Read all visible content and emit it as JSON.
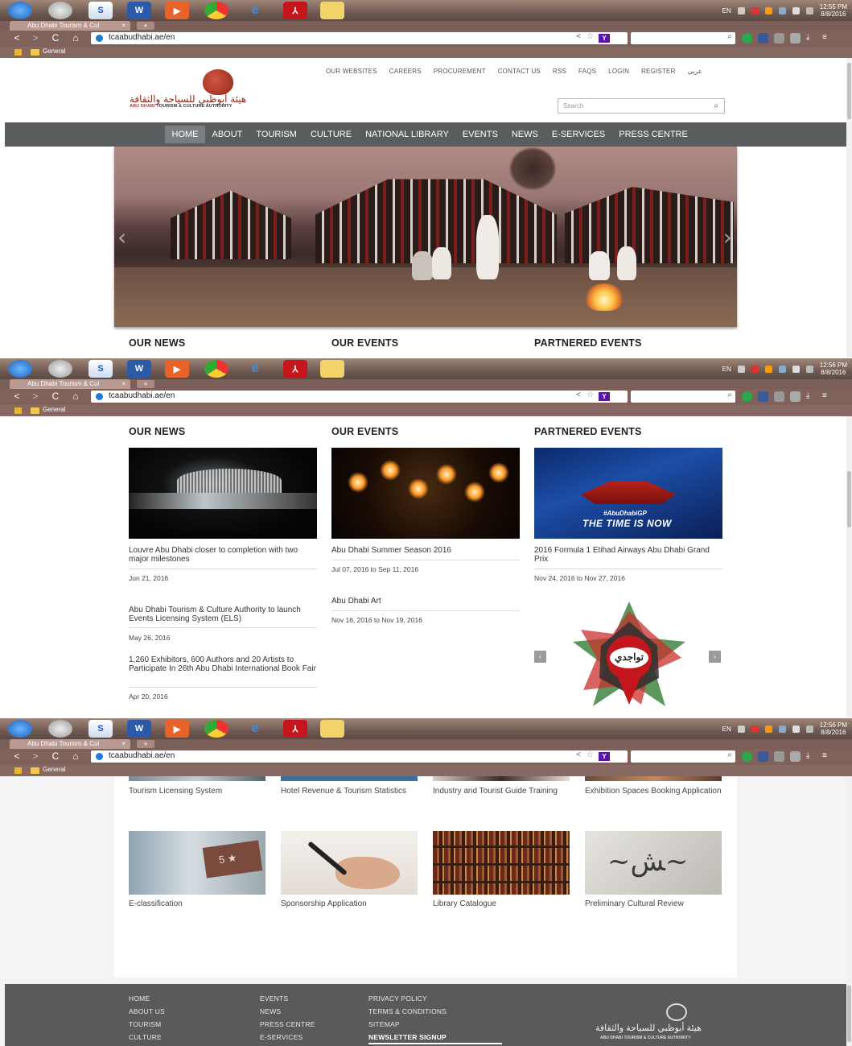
{
  "os": {
    "taskbar_apps": [
      "windows-orb",
      "media-icon",
      "snagit-icon",
      "word-icon",
      "video-icon",
      "chrome-icon",
      "ie-icon",
      "acrobat-icon",
      "folder-icon"
    ],
    "word_label": "W",
    "language": "EN",
    "clocks": [
      {
        "time": "12:55 PM",
        "date": "8/8/2016"
      },
      {
        "time": "12:56 PM",
        "date": "8/8/2016"
      },
      {
        "time": "12:56 PM",
        "date": "8/8/2016"
      }
    ]
  },
  "browser": {
    "tab_title": "Abu Dhabi Tourism & Cul",
    "tab_close": "×",
    "new_tab": "+",
    "url": "tcaabudhabi.ae/en",
    "yahoo_label": "Y",
    "bookmark_folder": "General",
    "nav": {
      "back": "<",
      "forward": ">",
      "reload": "C",
      "home": "⌂"
    }
  },
  "site": {
    "top_links": [
      "OUR WEBSITES",
      "CAREERS",
      "PROCUREMENT",
      "CONTACT US",
      "RSS",
      "FAQS",
      "LOGIN",
      "REGISTER",
      "عربي"
    ],
    "logo_arabic": "هيئة أبوظبي للسياحة والثقافة",
    "logo_english_1": "ABU DHABI",
    "logo_english_2": " TOURISM & CULTURE AUTHORITY",
    "search_placeholder": "Search",
    "main_nav": [
      "HOME",
      "ABOUT",
      "TOURISM",
      "CULTURE",
      "NATIONAL LIBRARY",
      "EVENTS",
      "NEWS",
      "E-SERVICES",
      "PRESS CENTRE"
    ],
    "active_nav": "HOME",
    "hero_prev": "‹",
    "hero_next": "›",
    "sections": [
      "OUR NEWS",
      "OUR EVENTS",
      "PARTNERED EVENTS"
    ]
  },
  "news": [
    {
      "title": "Louvre Abu Dhabi closer to completion with two major milestones",
      "date": "Jun 21, 2016"
    },
    {
      "title": "Abu Dhabi Tourism & Culture Authority to launch Events Licensing System (ELS)",
      "date": "May 26, 2016"
    },
    {
      "title": "1,260 Exhibitors, 600 Authors and 20 Artists to Participate In 26th Abu Dhabi International Book Fair",
      "date": "Apr 20, 2016"
    }
  ],
  "events": [
    {
      "title": "Abu Dhabi Summer Season 2016",
      "date": "Jul 07, 2016 to Sep 11, 2016"
    },
    {
      "title": "Abu Dhabi Art",
      "date": "Nov 16, 2016 to Nov 19, 2016"
    }
  ],
  "partnered": {
    "title": "2016 Formula 1 Etihad Airways Abu Dhabi Grand Prix",
    "date": "Nov 24, 2016 to Nov 27, 2016",
    "image_text_1": "#AbuDhabiGP",
    "image_text_2": "THE TIME IS NOW",
    "badge_text": "تواجدي",
    "prev": "‹",
    "next": "›"
  },
  "services_row1": [
    "Tourism Licensing System",
    "Hotel Revenue & Tourism Statistics",
    "Industry and Tourist Guide Training",
    "Exhibition Spaces Booking Application"
  ],
  "services_row2": [
    "E-classification",
    "Sponsorship Application",
    "Library Catalogue",
    "Preliminary Cultural Review"
  ],
  "eclass_plaque": "5 ★",
  "footer": {
    "col1": [
      "HOME",
      "ABOUT US",
      "TOURISM",
      "CULTURE"
    ],
    "col2": [
      "EVENTS",
      "NEWS",
      "PRESS CENTRE",
      "E-SERVICES"
    ],
    "col3": [
      "PRIVACY POLICY",
      "TERMS & CONDITIONS",
      "SITEMAP",
      "NEWSLETTER SIGNUP"
    ],
    "logo_arabic": "هيئة أبوظبي للسياحة والثقافة",
    "logo_english": "ABU DHABI TOURISM & CULTURE AUTHORITY"
  },
  "colors": {
    "nav_bg": "#595d5e",
    "brand_red": "#8e2a1d",
    "footer_bg": "#5a5a5c"
  }
}
